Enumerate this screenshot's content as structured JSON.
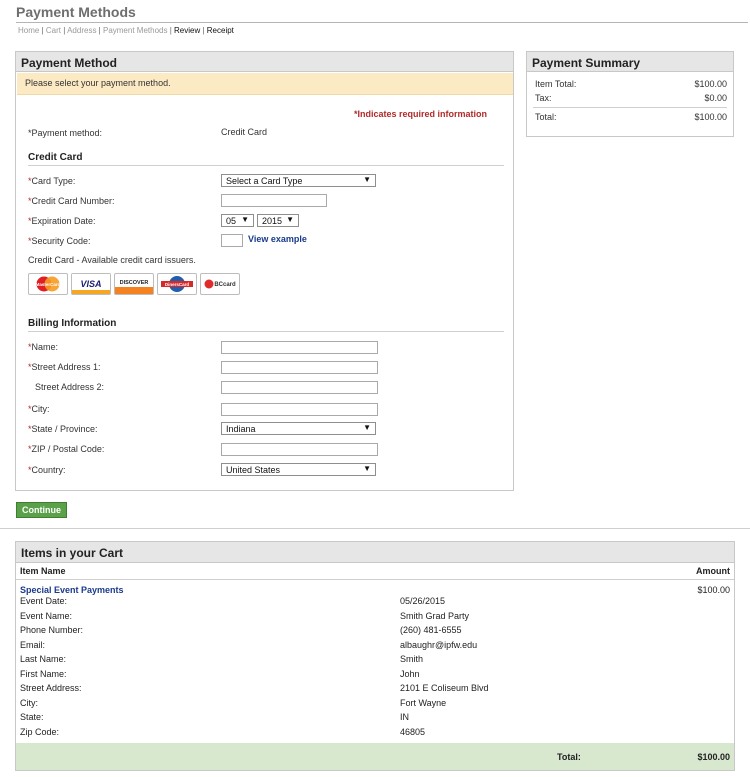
{
  "page": {
    "title": "Payment Methods",
    "breadcrumb": {
      "home": "Home",
      "cart": "Cart",
      "address": "Address",
      "payment_methods": "Payment Methods",
      "review": "Review",
      "receipt": "Receipt"
    }
  },
  "payment_method_panel": {
    "title": "Payment Method",
    "notice": "Please select your payment method.",
    "required_note": "*Indicates required information",
    "method_label": "*Payment method:",
    "method_value": "Credit Card",
    "credit_card": {
      "heading": "Credit Card",
      "card_type_label": "Card Type:",
      "card_type_value": "Select a Card Type",
      "card_number_label": "Credit Card Number:",
      "expiration_label": "Expiration Date:",
      "exp_month": "05",
      "exp_year": "2015",
      "security_label": "Security Code:",
      "view_example": "View example",
      "issuers_text": "Credit Card - Available credit card issuers.",
      "issuers": [
        "MasterCard",
        "VISA",
        "DISCOVER",
        "DinersCard",
        "BCcard"
      ]
    },
    "billing": {
      "heading": "Billing Information",
      "name_label": "Name:",
      "street1_label": "Street Address 1:",
      "street2_label": "Street Address 2:",
      "city_label": "City:",
      "state_label": "State / Province:",
      "state_value": "Indiana",
      "zip_label": "ZIP / Postal Code:",
      "country_label": "Country:",
      "country_value": "United States"
    }
  },
  "summary": {
    "title": "Payment Summary",
    "item_total_label": "Item Total:",
    "item_total_value": "$100.00",
    "tax_label": "Tax:",
    "tax_value": "$0.00",
    "total_label": "Total:",
    "total_value": "$100.00"
  },
  "continue_label": "Continue",
  "cart": {
    "title": "Items in your Cart",
    "col_item": "Item Name",
    "col_amount": "Amount",
    "item_name": "Special Event Payments",
    "item_amount": "$100.00",
    "rows": [
      {
        "label": "Event Date:",
        "value": "05/26/2015"
      },
      {
        "label": "Event Name:",
        "value": "Smith Grad Party"
      },
      {
        "label": "Phone Number:",
        "value": "(260) 481-6555"
      },
      {
        "label": "Email:",
        "value": "albaughr@ipfw.edu"
      },
      {
        "label": "Last Name:",
        "value": "Smith"
      },
      {
        "label": "First Name:",
        "value": "John"
      },
      {
        "label": "Street Address:",
        "value": "2101 E Coliseum Blvd"
      },
      {
        "label": "City:",
        "value": "Fort Wayne"
      },
      {
        "label": "State:",
        "value": "IN"
      },
      {
        "label": "Zip Code:",
        "value": "46805"
      }
    ],
    "total_label": "Total:",
    "total_value": "$100.00"
  },
  "colors": {
    "required": "#b12a2a",
    "link": "#1a3a8c",
    "notice_bg": "#fceac4",
    "button_bg": "#5aa14a",
    "cart_footer_bg": "#d8e8cf"
  }
}
